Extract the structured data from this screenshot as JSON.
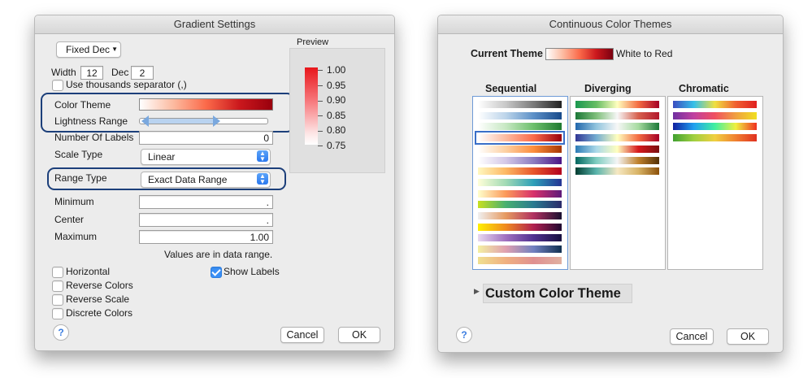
{
  "gradient_dialog": {
    "title": "Gradient Settings",
    "format_popup": "Fixed Dec",
    "width_label": "Width",
    "width_value": "12",
    "dec_label": "Dec",
    "dec_value": "2",
    "thousands_label": "Use thousands separator (,)",
    "color_theme_label": "Color Theme",
    "lightness_label": "Lightness Range",
    "num_labels_label": "Number Of Labels",
    "num_labels_value": "0",
    "scale_type_label": "Scale Type",
    "scale_type_value": "Linear",
    "range_type_label": "Range Type",
    "range_type_value": "Exact Data Range",
    "minimum_label": "Minimum",
    "minimum_value": ".",
    "center_label": "Center",
    "center_value": ".",
    "maximum_label": "Maximum",
    "maximum_value": "1.00",
    "data_range_note": "Values are in data range.",
    "horizontal_label": "Horizontal",
    "show_labels_label": "Show Labels",
    "reverse_colors_label": "Reverse Colors",
    "reverse_scale_label": "Reverse Scale",
    "discrete_colors_label": "Discrete Colors",
    "cancel_label": "Cancel",
    "ok_label": "OK",
    "help_label": "?",
    "preview_label": "Preview",
    "preview_ticks": [
      "1.00",
      "0.95",
      "0.90",
      "0.85",
      "0.80",
      "0.75"
    ],
    "checks": {
      "thousands": false,
      "horizontal": false,
      "show_labels": true,
      "reverse_colors": false,
      "reverse_scale": false,
      "discrete_colors": false
    }
  },
  "theme_dialog": {
    "title": "Continuous Color Themes",
    "current_theme_label": "Current Theme",
    "current_theme_name": "White to Red",
    "sequential_header": "Sequential",
    "diverging_header": "Diverging",
    "chromatic_header": "Chromatic",
    "custom_theme_label": "Custom Color Theme",
    "cancel_label": "Cancel",
    "ok_label": "OK",
    "help_label": "?",
    "selected_sequential_index": 3,
    "sequential": [
      "linear-gradient(90deg,#ffffff,#c8c8c8,#7a7a7a,#222222)",
      "linear-gradient(90deg,#ffffff,#bcd4ea,#5b8fc7,#174a8a)",
      "linear-gradient(90deg,#ffffff,#c7e8c3,#6cbf6c,#1f7a30)",
      "linear-gradient(90deg,#ffffff,#fcbba1,#fb6a4a,#99000d)",
      "linear-gradient(90deg,#ffffff,#fdd0a2,#fd8d3c,#a63603)",
      "linear-gradient(90deg,#ffffff,#d4c8e8,#8c7cc0,#4a1486)",
      "linear-gradient(90deg,#fff8c0,#fdb863,#e8552a,#b3001e)",
      "linear-gradient(90deg,#ffffd9,#a1dab4,#2c9fb8,#253494)",
      "linear-gradient(90deg,#ffffcc,#fc9a5a,#d7306a,#5e1a7a)",
      "linear-gradient(90deg,#c8e020,#48b070,#2a7a90,#2b2a6a)",
      "linear-gradient(90deg,#f0f0f0,#e69a60,#b03060,#1a1030)",
      "linear-gradient(90deg,#fff000,#f08a20,#b02050,#200830)",
      "linear-gradient(90deg,#e8d8f0,#a070c0,#503090,#181040)",
      "linear-gradient(90deg,#f4f0a0,#e0a0b0,#7080c0,#103050)",
      "linear-gradient(90deg,#f0e090,#f0b080,#e09090,#e0b0a0)"
    ],
    "diverging": [
      "linear-gradient(90deg,#1a9850,#66bd63,#ffffbf,#f46d43,#a50026)",
      "linear-gradient(90deg,#1b7837,#7fbf7b,#f7f7f7,#d6604d,#b2182b)",
      "linear-gradient(90deg,#2166ac,#92c5de,#f7f7f7,#a6dba0,#1b7837)",
      "linear-gradient(90deg,#313695,#74add1,#ffffbf,#f46d43,#a50026)",
      "linear-gradient(90deg,#2c7bb6,#abd9e9,#ffffbf,#d7191c,#7a0f10)",
      "linear-gradient(90deg,#01665e,#80cdc1,#f5f5f5,#bf812d,#543005)",
      "linear-gradient(90deg,#003c30,#5ab4ac,#f6e8c3,#d8b365,#8c510a)"
    ],
    "chromatic": [
      "linear-gradient(90deg,#3b4cc0,#35c0e8,#f0e040,#f06030,#e02020)",
      "linear-gradient(90deg,#7030a0,#c040a0,#f05060,#f0a040,#f0e020)",
      "linear-gradient(90deg,#1020a0,#20a0f0,#40f0a0,#f0f040,#f03020)",
      "linear-gradient(90deg,#40a030,#a0d040,#f0d040,#f08030,#e03020)"
    ]
  },
  "colors": {
    "outline": "#1c3f7a",
    "selection": "#3a6fc8",
    "accent": "#3a8ff5"
  }
}
